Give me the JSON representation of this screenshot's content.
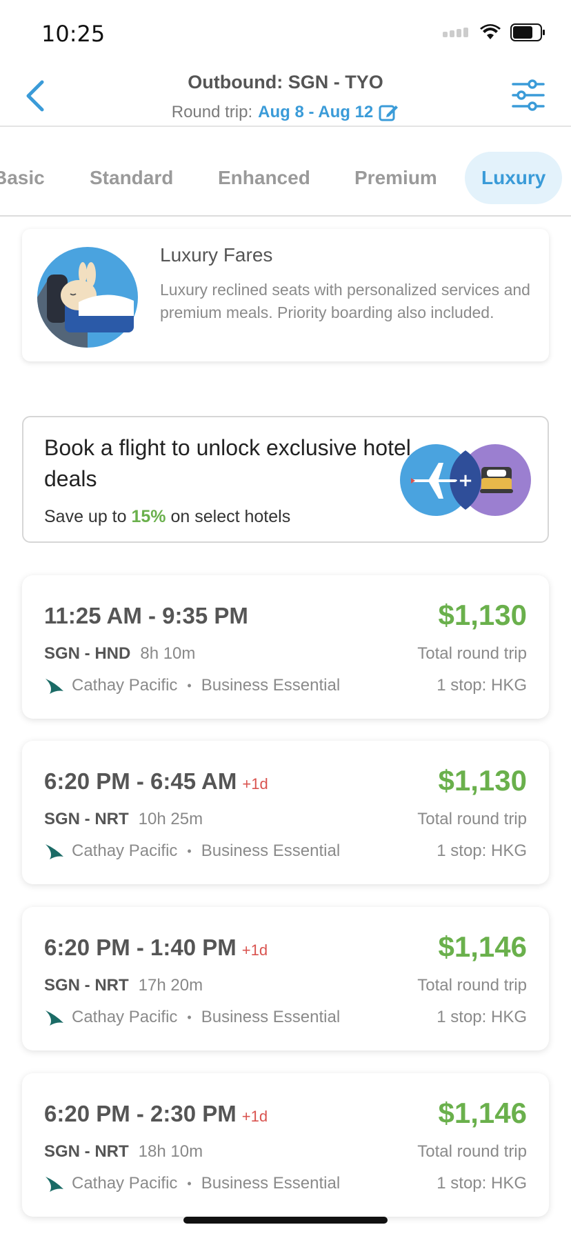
{
  "status_bar": {
    "time": "10:25"
  },
  "header": {
    "title": "Outbound: SGN - TYO",
    "subtitle_label": "Round trip:",
    "subtitle_dates": "Aug 8 - Aug 12"
  },
  "tabs": [
    {
      "label": "Basic",
      "active": false
    },
    {
      "label": "Standard",
      "active": false
    },
    {
      "label": "Enhanced",
      "active": false
    },
    {
      "label": "Premium",
      "active": false
    },
    {
      "label": "Luxury",
      "active": true
    }
  ],
  "fare_info": {
    "title": "Luxury Fares",
    "description": "Luxury reclined seats with personalized services and premium meals. Priority boarding also included."
  },
  "promo": {
    "title": "Book a flight to unlock exclusive hotel deals",
    "sub_prefix": "Save up to",
    "sub_pct": "15%",
    "sub_suffix": "on select hotels"
  },
  "flights": [
    {
      "times": "11:25 AM - 9:35 PM",
      "day_offset": "",
      "route": "SGN - HND",
      "duration": "8h 10m",
      "airline": "Cathay Pacific",
      "fare_class": "Business Essential",
      "price": "$1,130",
      "price_label": "Total round trip",
      "stops": "1 stop: HKG"
    },
    {
      "times": "6:20 PM - 6:45 AM",
      "day_offset": "+1d",
      "route": "SGN - NRT",
      "duration": "10h 25m",
      "airline": "Cathay Pacific",
      "fare_class": "Business Essential",
      "price": "$1,130",
      "price_label": "Total round trip",
      "stops": "1 stop: HKG"
    },
    {
      "times": "6:20 PM - 1:40 PM",
      "day_offset": "+1d",
      "route": "SGN - NRT",
      "duration": "17h 20m",
      "airline": "Cathay Pacific",
      "fare_class": "Business Essential",
      "price": "$1,146",
      "price_label": "Total round trip",
      "stops": "1 stop: HKG"
    },
    {
      "times": "6:20 PM - 2:30 PM",
      "day_offset": "+1d",
      "route": "SGN - NRT",
      "duration": "18h 10m",
      "airline": "Cathay Pacific",
      "fare_class": "Business Essential",
      "price": "$1,146",
      "price_label": "Total round trip",
      "stops": "1 stop: HKG"
    }
  ],
  "colors": {
    "accent": "#3a9bd8",
    "price": "#6ab04c",
    "day_offset": "#d9534f",
    "airline_logo": "#1b6b66"
  }
}
